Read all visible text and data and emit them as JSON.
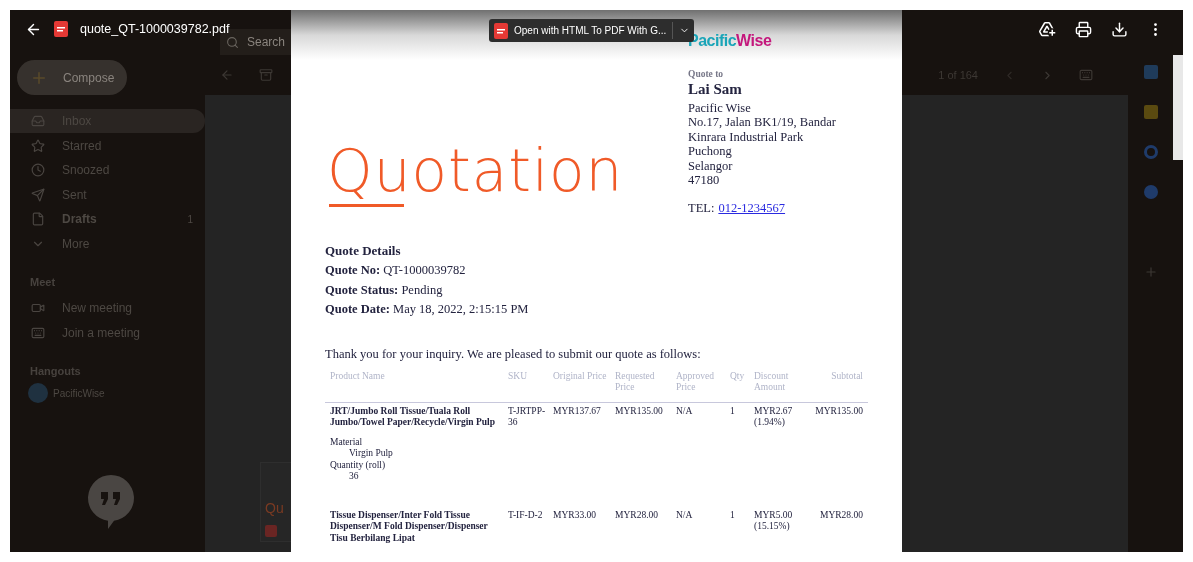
{
  "viewer": {
    "file_name": "quote_QT-1000039782.pdf",
    "open_with": "Open with HTML To PDF With G..."
  },
  "gmail": {
    "search_placeholder": "Search",
    "compose": "Compose",
    "nav": [
      {
        "kind": "inbox",
        "label": "Inbox",
        "selected": true
      },
      {
        "kind": "star",
        "label": "Starred",
        "selected": false
      },
      {
        "kind": "clock",
        "label": "Snoozed",
        "selected": false
      },
      {
        "kind": "send",
        "label": "Sent",
        "selected": false
      },
      {
        "kind": "file",
        "label": "Drafts",
        "count": "1",
        "selected": false
      },
      {
        "kind": "chevron",
        "label": "More",
        "selected": false
      }
    ],
    "meet": {
      "heading": "Meet",
      "items": [
        {
          "kind": "video",
          "label": "New meeting"
        },
        {
          "kind": "keyboard",
          "label": "Join a meeting"
        }
      ]
    },
    "hangouts": {
      "heading": "Hangouts",
      "contacts": [
        {
          "name": "PacificWise"
        }
      ]
    },
    "pager": "1 of 164",
    "attachment_preview": "Qu"
  },
  "document": {
    "logo": [
      {
        "text": "Pacific",
        "color": "#1aa5b8"
      },
      {
        "text": "Wise",
        "color": "#c4177c"
      }
    ],
    "title": "Quotation",
    "quote_to": {
      "label": "Quote to",
      "name": "Lai Sam",
      "address": [
        "Pacific Wise",
        "No.17, Jalan BK1/19, Bandar",
        "Kinrara Industrial Park",
        "Puchong",
        "Selangor",
        "47180"
      ],
      "tel_label": "TEL:",
      "tel": "012-1234567"
    },
    "details": {
      "heading": "Quote Details",
      "lines": [
        "**Quote No:** QT-1000039782",
        "**Quote Status:** Pending",
        "**Quote Date:** May 18, 2022, 2:15:15 PM"
      ]
    },
    "intro": "Thank you for your inquiry. We are pleased to submit our quote as follows:",
    "table": {
      "columns": [
        "Product Name",
        "SKU",
        "Original Price",
        "Requested Price",
        "Approved Price",
        "Qty",
        "Discount Amount",
        "Subtotal"
      ],
      "rows": [
        {
          "product": "JRT/Jumbo Roll Tissue/Tuala Roll Jumbo/Towel Paper/Recycle/Virgin Pulp",
          "options": [
            {
              "name": "Material",
              "value": "Virgin Pulp"
            },
            {
              "name": "Quantity (roll)",
              "value": "36"
            }
          ],
          "sku": "T-JRTPP-36",
          "original": "MYR137.67",
          "requested": "MYR135.00",
          "approved": "N/A",
          "qty": "1",
          "discount": "MYR2.67 (1.94%)",
          "subtotal": "MYR135.00"
        },
        {
          "product": "Tissue Dispenser/Inter Fold Tissue Dispenser/M Fold Dispenser/Dispenser Tisu Berbilang Lipat",
          "options": [],
          "sku": "T-IF-D-2",
          "original": "MYR33.00",
          "requested": "MYR28.00",
          "approved": "N/A",
          "qty": "1",
          "discount": "MYR5.00 (15.15%)",
          "subtotal": "MYR28.00"
        }
      ]
    }
  }
}
